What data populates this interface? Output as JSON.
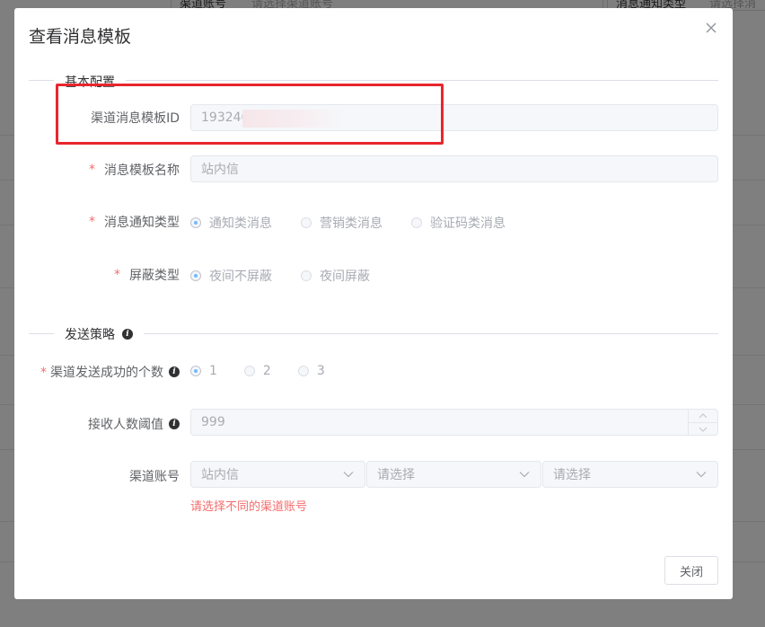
{
  "background": {
    "filter_label_1": "渠道账号",
    "filter_placeholder_1": "请选择渠道账号",
    "filter_label_2": "消息通知类型",
    "filter_placeholder_2": "请选择消"
  },
  "dialog": {
    "title": "查看消息模板",
    "close_icon": "close-icon",
    "close_button_label": "关闭"
  },
  "sections": {
    "basic": "基本配置",
    "strategy": "发送策略"
  },
  "form": {
    "template_id": {
      "label": "渠道消息模板ID",
      "value": "193240",
      "required": false
    },
    "template_name": {
      "label": "消息模板名称",
      "value": "站内信",
      "required": true
    },
    "notify_type": {
      "label": "消息通知类型",
      "required": true,
      "options": [
        "通知类消息",
        "营销类消息",
        "验证码类消息"
      ],
      "selected": 0
    },
    "shield_type": {
      "label": "屏蔽类型",
      "required": true,
      "options": [
        "夜间不屏蔽",
        "夜间屏蔽"
      ],
      "selected": 0
    },
    "success_count": {
      "label": "渠道发送成功的个数",
      "required": true,
      "options": [
        "1",
        "2",
        "3"
      ],
      "selected": 0
    },
    "receiver_threshold": {
      "label": "接收人数阈值",
      "value": "999"
    },
    "channel_account": {
      "label": "渠道账号",
      "selects": [
        "站内信",
        "请选择",
        "请选择"
      ],
      "error": "请选择不同的渠道账号"
    }
  },
  "colors": {
    "highlight": "#e8262d",
    "required_star": "#f56c6c",
    "radio_dot": "#409eff"
  }
}
